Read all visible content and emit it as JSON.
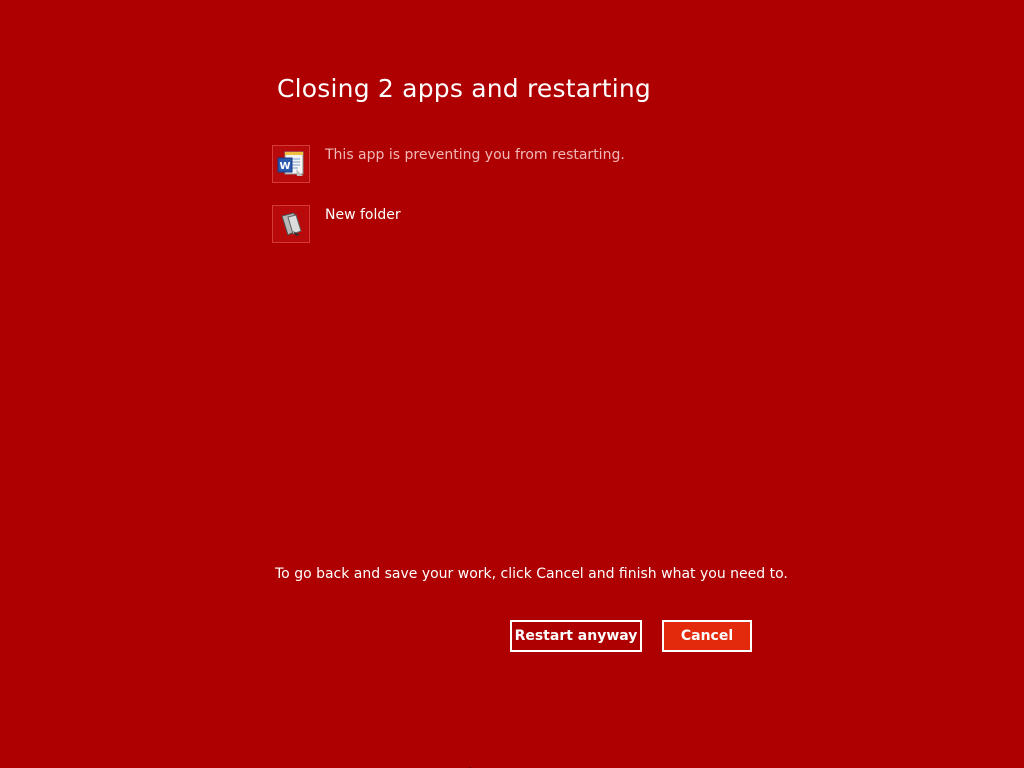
{
  "dialog": {
    "title": "Closing 2 apps and restarting",
    "apps": [
      {
        "icon": "word-document-icon",
        "label": "This app is preventing you from restarting."
      },
      {
        "icon": "folder-icon",
        "label": "New folder"
      }
    ],
    "message": "To go back and save your work, click Cancel and finish what you need to.",
    "buttons": {
      "restart_label": "Restart anyway",
      "cancel_label": "Cancel"
    }
  },
  "colors": {
    "background": "#ae0000",
    "cancel_button": "#e32a0c",
    "text": "#ffffff"
  }
}
